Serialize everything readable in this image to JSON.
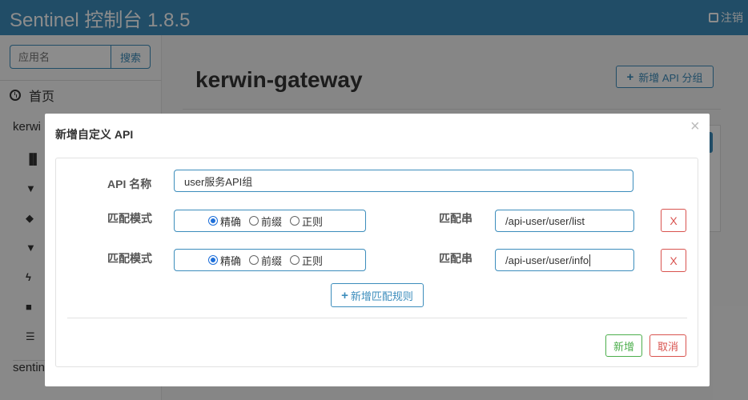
{
  "header": {
    "brand": "Sentinel 控制台 1.8.5",
    "logout_label": "注销"
  },
  "sidebar": {
    "search_placeholder": "应用名",
    "search_button": "搜索",
    "home_label": "首页",
    "app_name": "kerwi",
    "sentinel_label": "sentin"
  },
  "content": {
    "title": "kerwin-gateway",
    "add_group_button": "新增 API 分组"
  },
  "modal": {
    "title": "新增自定义 API",
    "close_symbol": "×",
    "api_name_label": "API 名称",
    "api_name_value": "user服务API组",
    "rules": [
      {
        "mode_label": "匹配模式",
        "options": [
          "精确",
          "前缀",
          "正则"
        ],
        "selected": "精确",
        "pattern_label": "匹配串",
        "pattern_value": "/api-user/user/list",
        "remove_label": "X"
      },
      {
        "mode_label": "匹配模式",
        "options": [
          "精确",
          "前缀",
          "正则"
        ],
        "selected": "精确",
        "pattern_label": "匹配串",
        "pattern_value": "/api-user/user/info",
        "remove_label": "X"
      }
    ],
    "add_rule_button": "新增匹配规则",
    "confirm_button": "新增",
    "cancel_button": "取消"
  },
  "colors": {
    "primary": "#3c8dbc",
    "success": "#4cae4c",
    "danger": "#d9534f"
  }
}
